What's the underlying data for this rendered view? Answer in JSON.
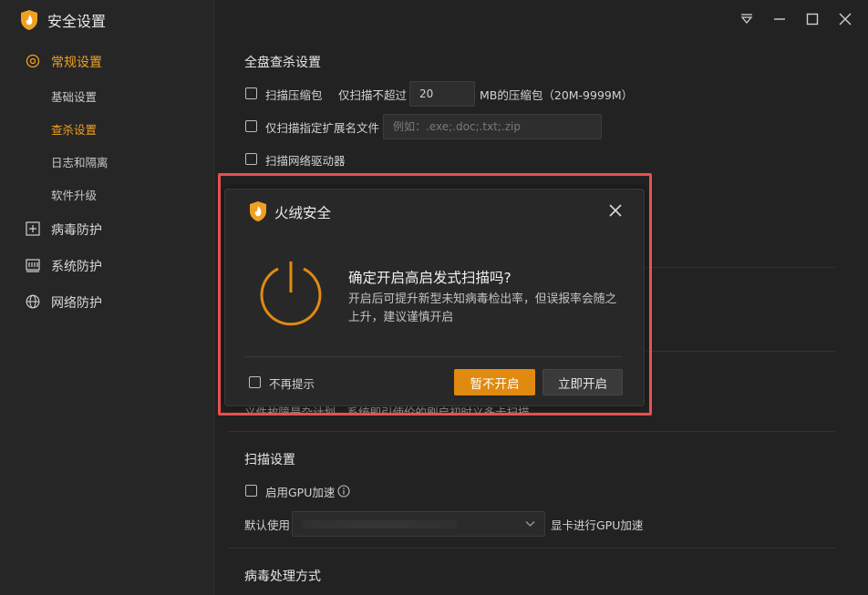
{
  "app": {
    "title": "安全设置"
  },
  "sidebar": {
    "groups": [
      {
        "label": "常规设置",
        "icon": "gear-icon",
        "active": true,
        "items": [
          {
            "label": "基础设置"
          },
          {
            "label": "查杀设置",
            "active": true
          },
          {
            "label": "日志和隔离"
          },
          {
            "label": "软件升级"
          }
        ]
      },
      {
        "label": "病毒防护",
        "icon": "plus-box-icon"
      },
      {
        "label": "系统防护",
        "icon": "system-icon"
      },
      {
        "label": "网络防护",
        "icon": "globe-icon"
      }
    ]
  },
  "content": {
    "full_scan": {
      "title": "全盘查杀设置",
      "scan_archive_label": "扫描压缩包",
      "only_scan_not_exceed": "仅扫描不超过",
      "archive_size_value": "20",
      "archive_size_suffix": "MB的压缩包（20M-9999M）",
      "ext_label": "仅扫描指定扩展名文件",
      "ext_placeholder": "例如：.exe;.doc;.txt;.zip",
      "network_drive_label": "扫描网络驱动器",
      "obscured_text": "义件故障是杂计划，系统即引使伦的刷启初时义多卡扫描"
    },
    "scan_settings": {
      "title": "扫描设置",
      "gpu_label": "启用GPU加速",
      "default_use": "默认使用",
      "gpu_suffix": "显卡进行GPU加速"
    },
    "virus_handling": {
      "title": "病毒处理方式"
    }
  },
  "dialog": {
    "title": "火绒安全",
    "heading": "确定开启高启发式扫描吗?",
    "body": "开启后可提升新型未知病毒检出率，但误报率会随之上升，建议谨慎开启",
    "dont_remind": "不再提示",
    "cancel_button": "暂不开启",
    "confirm_button": "立即开启"
  },
  "colors": {
    "accent": "#e08a10",
    "highlight": "#e85050"
  }
}
